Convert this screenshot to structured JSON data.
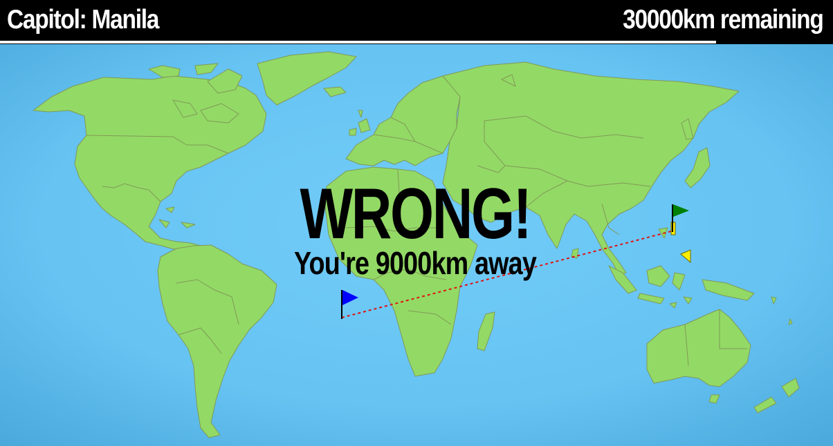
{
  "hud": {
    "capital_label": "Capitol: Manila",
    "distance_remaining": "30000km remaining",
    "remaining_fraction": 0.86
  },
  "result": {
    "title": "WRONG!",
    "detail": "You're 9000km away"
  },
  "markers": {
    "guess_flag_icon": "blue-flag",
    "answer_flag_icon": "green-flag",
    "previous_marker_icon": "yellow-marker"
  },
  "colors": {
    "ocean": "#6ccaf7",
    "land": "#93d966",
    "border": "#7f9a55",
    "guess_flag": "#0000ff",
    "answer_flag": "#008000",
    "previous_marker": "#ffee00",
    "distance_line": "#e01010",
    "hud_background": "#000000",
    "hud_text": "#ffffff"
  }
}
